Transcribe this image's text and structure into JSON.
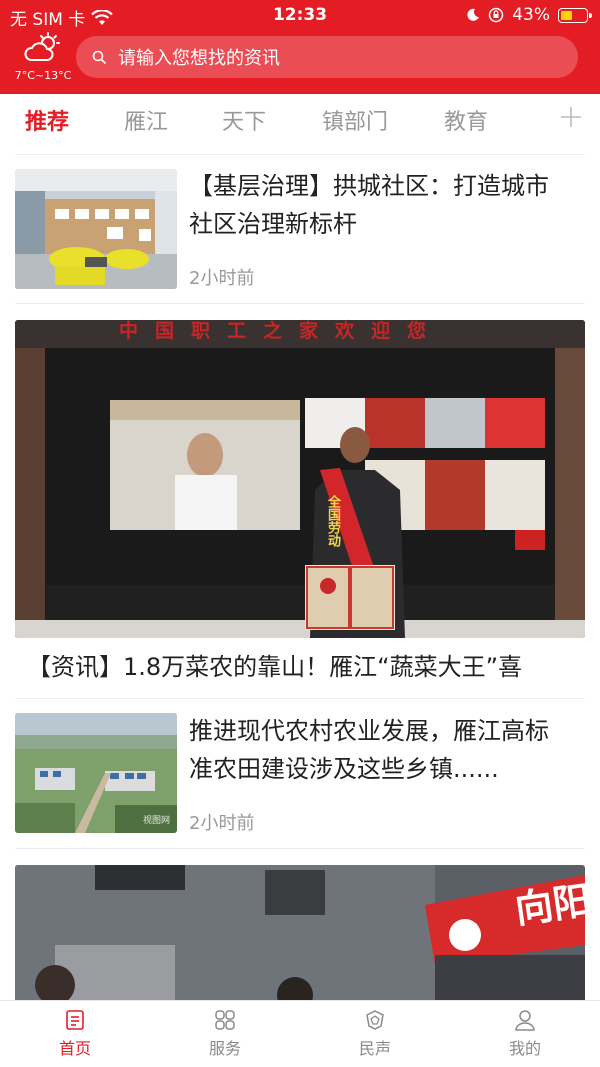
{
  "status_bar": {
    "carrier": "无 SIM 卡",
    "time": "12:33",
    "battery": "43%"
  },
  "weather": {
    "temp": "7°C~13°C",
    "icon": "partly-cloudy-icon"
  },
  "search": {
    "placeholder": "请输入您想找的资讯"
  },
  "tabs": [
    "推荐",
    "雁江",
    "天下",
    "镇部门",
    "教育"
  ],
  "news": [
    {
      "title": "【基层治理】拱城社区：打造城市社区治理新标杆",
      "time": "2小时前"
    },
    {
      "title": "【资讯】1.8万菜农的靠山！雁江“蔬菜大王”喜",
      "banner_text": "中国职工之家欢迎您",
      "sash_text": "全国劳动"
    },
    {
      "title": "推进现代农村农业发展，雁江高标准农田建设涉及这些乡镇......",
      "time": "2小时前",
      "watermark": "视图网"
    },
    {
      "sign_text": "向阳"
    }
  ],
  "bottom_nav": [
    {
      "label": "首页",
      "icon": "home-icon"
    },
    {
      "label": "服务",
      "icon": "grid-icon"
    },
    {
      "label": "民声",
      "icon": "voice-icon"
    },
    {
      "label": "我的",
      "icon": "user-icon"
    }
  ],
  "colors": {
    "brand": "#e41d25",
    "muted": "#999999",
    "battery": "#ffd400"
  }
}
